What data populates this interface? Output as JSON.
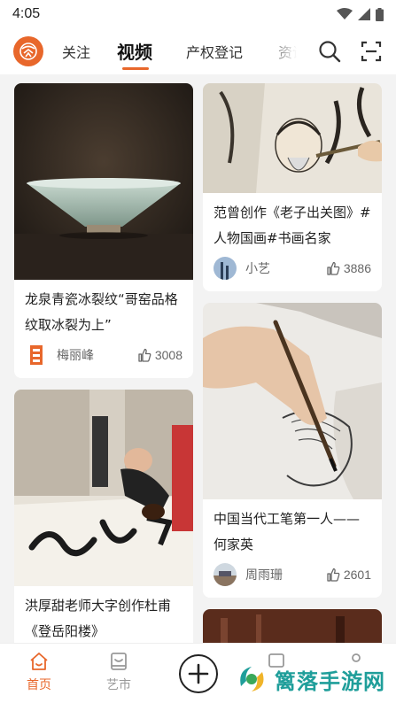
{
  "status_bar": {
    "time": "4:05"
  },
  "top_nav": {
    "tabs": [
      {
        "label": "关注",
        "active": false
      },
      {
        "label": "视频",
        "active": true
      },
      {
        "label": "产权登记",
        "active": false
      },
      {
        "label": "资讯",
        "active": false
      }
    ],
    "icons": {
      "search": "search-icon",
      "scan": "scan-icon"
    },
    "accent_color": "#e8672b"
  },
  "feed": {
    "cards": [
      {
        "title": "龙泉青瓷冰裂纹“哥窑品格纹取冰裂为上”",
        "author": "梅丽峰",
        "likes": "3008"
      },
      {
        "title": "范曾创作《老子出关图》#人物国画#书画名家",
        "author": "小艺",
        "likes": "3886"
      },
      {
        "title": "洪厚甜老师大字创作杜甫《登岳阳楼》",
        "author": "",
        "likes": ""
      },
      {
        "title": "中国当代工笔第一人——何家英",
        "author": "周雨珊",
        "likes": "2601"
      }
    ]
  },
  "bottom_nav": {
    "items": [
      {
        "label": "首页",
        "icon": "home-icon",
        "active": true
      },
      {
        "label": "艺市",
        "icon": "market-icon",
        "active": false
      }
    ],
    "plus_icon": "plus-icon"
  },
  "watermark": {
    "text": "篱落手游网"
  }
}
